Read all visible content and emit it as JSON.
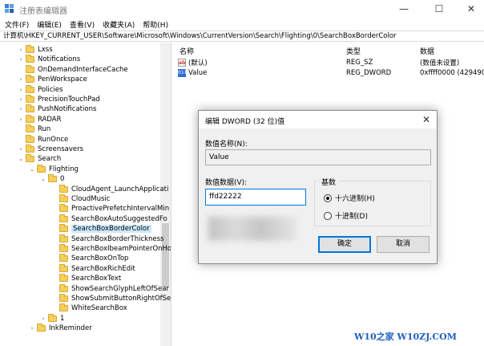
{
  "window": {
    "title": "注册表编辑器",
    "min_glyph": "—",
    "max_glyph": "☐",
    "close_glyph": "✕"
  },
  "menu": [
    "文件(F)",
    "编辑(E)",
    "查看(V)",
    "收藏夹(A)",
    "帮助(H)"
  ],
  "address": "计算机\\HKEY_CURRENT_USER\\Software\\Microsoft\\Windows\\CurrentVersion\\Search\\Flighting\\0\\SearchBoxBorderColor",
  "tree": {
    "items": [
      {
        "label": "Lxss",
        "chev": "›"
      },
      {
        "label": "Notifications",
        "chev": "›"
      },
      {
        "label": "OnDemandInterfaceCache",
        "chev": ""
      },
      {
        "label": "PenWorkspace",
        "chev": "›"
      },
      {
        "label": "Policies",
        "chev": "›"
      },
      {
        "label": "PrecisionTouchPad",
        "chev": "›"
      },
      {
        "label": "PushNotifications",
        "chev": "›"
      },
      {
        "label": "RADAR",
        "chev": "›"
      },
      {
        "label": "Run",
        "chev": ""
      },
      {
        "label": "RunOnce",
        "chev": ""
      },
      {
        "label": "Screensavers",
        "chev": "›"
      },
      {
        "label": "Search",
        "chev": "⌄"
      },
      {
        "label": "Flighting",
        "chev": "⌄"
      },
      {
        "label": "0",
        "chev": "⌄"
      },
      {
        "label": "CloudAgent_LaunchApplicati",
        "chev": ""
      },
      {
        "label": "CloudMusic",
        "chev": ""
      },
      {
        "label": "ProactivePrefetchIntervalMin",
        "chev": ""
      },
      {
        "label": "SearchBoxAutoSuggestedFo",
        "chev": ""
      },
      {
        "label": "SearchBoxBorderColor",
        "chev": ""
      },
      {
        "label": "SearchBoxBorderThickness",
        "chev": ""
      },
      {
        "label": "SearchBoxIbeamPointerOnHo",
        "chev": ""
      },
      {
        "label": "SearchBoxOnTop",
        "chev": ""
      },
      {
        "label": "SearchBoxRichEdit",
        "chev": ""
      },
      {
        "label": "SearchBoxText",
        "chev": ""
      },
      {
        "label": "ShowSearchGlyphLeftOfSear",
        "chev": ""
      },
      {
        "label": "ShowSubmitButtonRightOfSe",
        "chev": ""
      },
      {
        "label": "WhiteSearchBox",
        "chev": ""
      },
      {
        "label": "1",
        "chev": "›"
      },
      {
        "label": "InkReminder",
        "chev": "›"
      }
    ],
    "selected": "SearchBoxBorderColor"
  },
  "values_pane": {
    "headers": {
      "name": "名称",
      "type": "类型",
      "data": "数据"
    },
    "rows": [
      {
        "icon": "ab",
        "name": "(默认)",
        "type": "REG_SZ",
        "data": "(数值未设置)"
      },
      {
        "icon": "011",
        "name": "Value",
        "type": "REG_DWORD",
        "data": "0xffff0000 (4294901"
      }
    ]
  },
  "dialog": {
    "title": "编辑 DWORD (32 位)值",
    "close_glyph": "✕",
    "name_label": "数值名称(N):",
    "name_value": "Value",
    "data_label": "数值数据(V):",
    "data_value": "ffd22222",
    "base_label": "基数",
    "radio_hex": "十六进制(H)",
    "radio_dec": "十进制(D)",
    "ok": "确定",
    "cancel": "取消"
  },
  "watermark": "W10之家 W10ZJ.COM",
  "colors": {
    "accent": "#0078d7",
    "selection": "#cce8ff",
    "folder": "#f4cf5b"
  }
}
